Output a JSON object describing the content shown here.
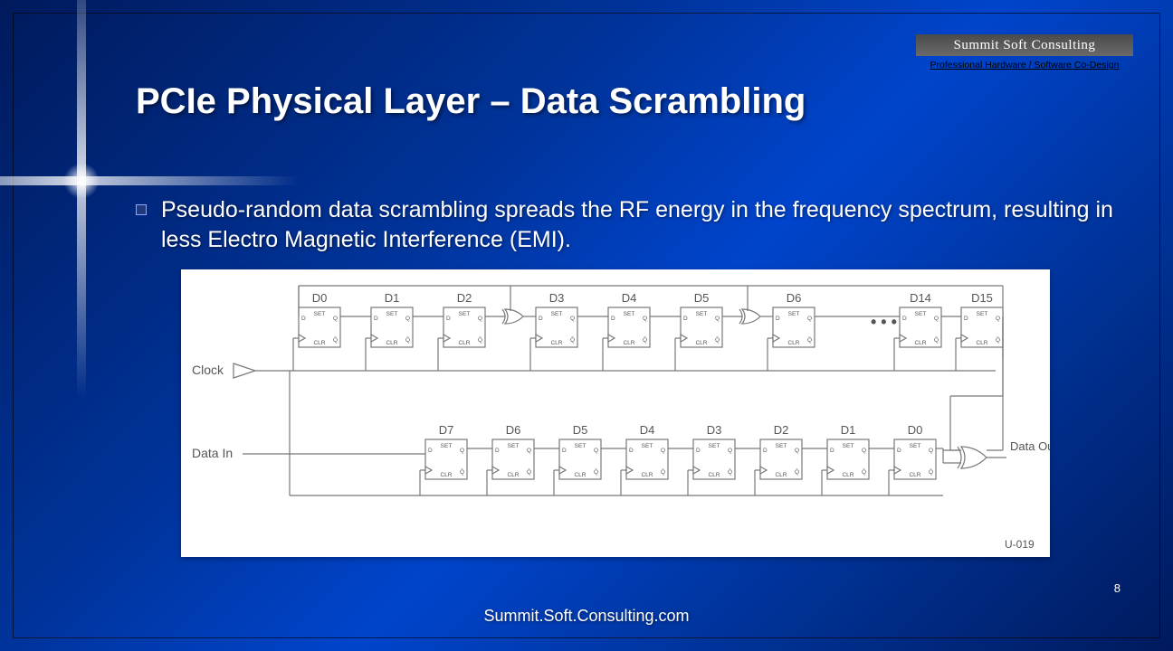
{
  "logo": {
    "company": "Summit Soft Consulting",
    "tagline": "Professional Hardware / Software Co-Design"
  },
  "title": "PCIe Physical Layer – Data Scrambling",
  "bullet": "Pseudo-random data scrambling spreads the RF energy in the frequency spectrum, resulting in less Electro Magnetic Interference (EMI).",
  "diagram": {
    "clock_label": "Clock",
    "data_in_label": "Data In",
    "data_out_label": "Data Out",
    "figure_id": "U-019",
    "ellipsis": "• • •",
    "top_row_labels": [
      "D0",
      "D1",
      "D2",
      "D3",
      "D4",
      "D5",
      "D6",
      "D14",
      "D15"
    ],
    "bottom_row_labels": [
      "D7",
      "D6",
      "D5",
      "D4",
      "D3",
      "D2",
      "D1",
      "D0"
    ],
    "ff_pins": {
      "d": "D",
      "q": "Q",
      "set": "SET",
      "clr": "CLR",
      "qbar": "Q̄"
    }
  },
  "footer": "Summit.Soft.Consulting.com",
  "page_number": "8"
}
